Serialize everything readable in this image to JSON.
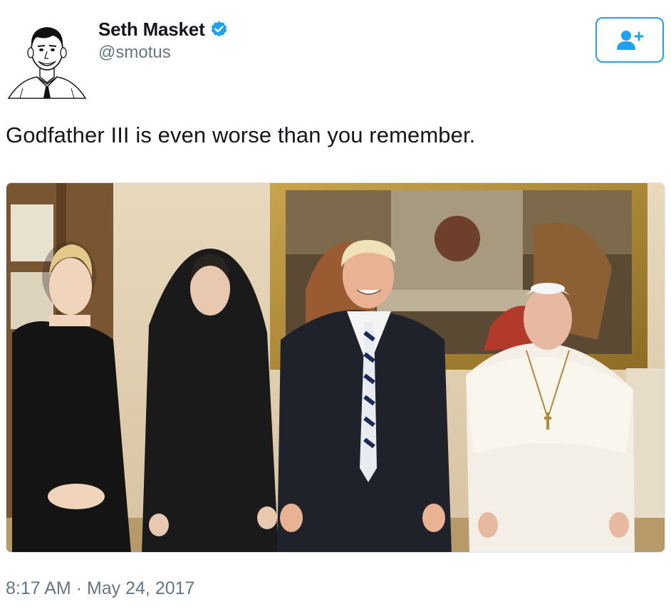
{
  "user": {
    "display_name": "Seth Masket",
    "handle": "@smotus",
    "verified": true,
    "avatar_icon": "cartoon-portrait-avatar"
  },
  "follow_button": {
    "icon": "add-user-icon",
    "color": "#1da1f2"
  },
  "tweet": {
    "text": "Godfather III is even worse than you remember.",
    "timestamp": "8:17 AM · May 24, 2017"
  },
  "colors": {
    "accent": "#1da1f2",
    "text": "#14171a",
    "muted": "#657786"
  }
}
